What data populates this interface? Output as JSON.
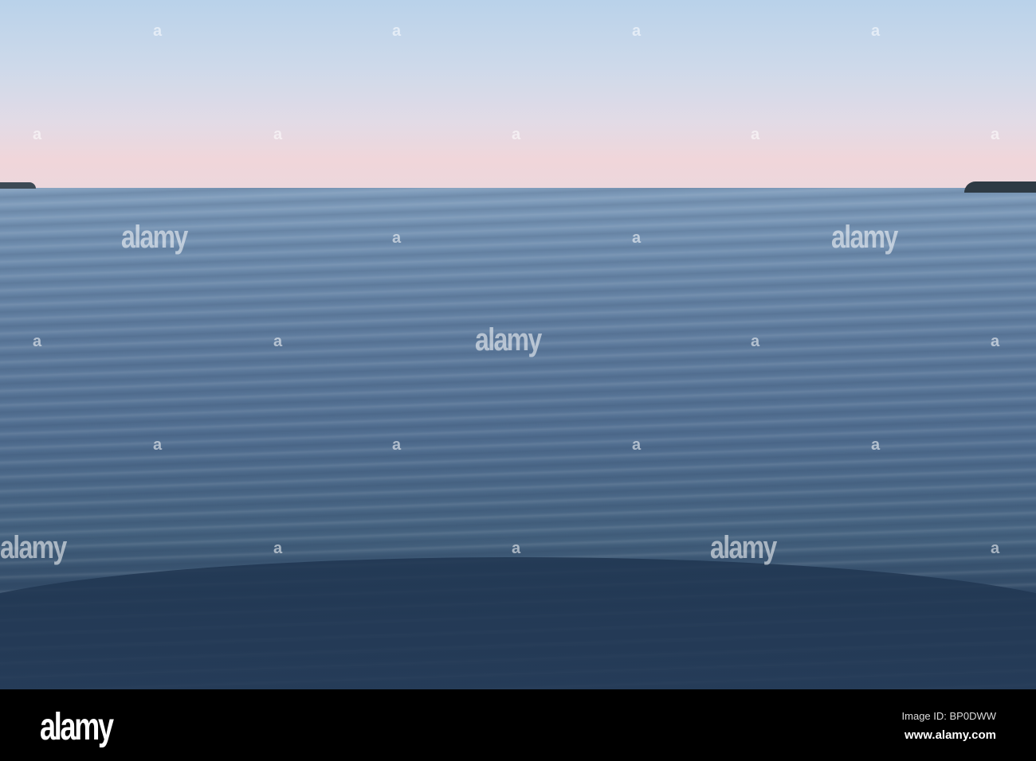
{
  "watermark": {
    "logo": "alamy",
    "small_mark": "a"
  },
  "footer": {
    "logo": "alamy",
    "image_id": "Image ID: BP0DWW",
    "url": "www.alamy.com"
  }
}
